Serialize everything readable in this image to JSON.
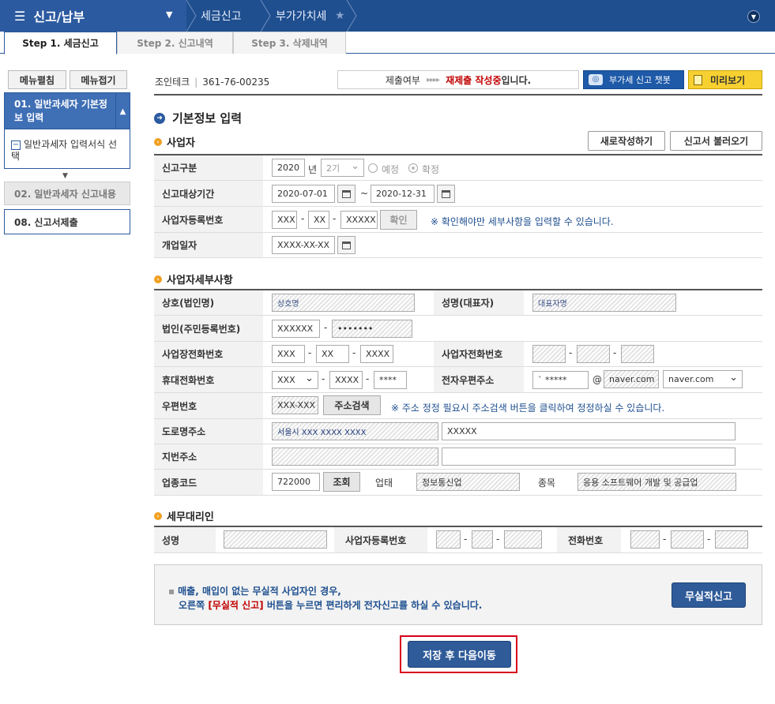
{
  "header": {
    "menu_icon": "☰",
    "menu_title": "신고/납부",
    "breadcrumb": [
      "세금신고",
      "부가가치세"
    ],
    "star_icon": "★",
    "collapse_icon": "chevron-down-icon"
  },
  "tabs": [
    {
      "label": "Step 1. 세금신고",
      "active": true
    },
    {
      "label": "Step 2. 신고내역",
      "active": false
    },
    {
      "label": "Step 3. 삭제내역",
      "active": false
    }
  ],
  "sidebar": {
    "expand_all": "메뉴펼침",
    "collapse_all": "메뉴접기",
    "items": [
      {
        "label": "01. 일반과세자 기본정보 입력",
        "active": true
      },
      {
        "label": "일반과세자 입력서식 선택"
      },
      {
        "label": "02. 일반과세자 신고내용"
      },
      {
        "label": "08. 신고서제출"
      }
    ]
  },
  "toolbar": {
    "company": "조인테크",
    "biz_no": "361-76-00235",
    "status_label": "제출여부",
    "status_arrows": "▸▸▸▸",
    "status_value": "재제출 작성중",
    "status_suffix": "입니다.",
    "chatbot": "부가세 신고 챗봇",
    "preview": "미리보기"
  },
  "main": {
    "title": "기본정보 입력",
    "business": {
      "heading": "사업자",
      "new_button": "새로작성하기",
      "load_button": "신고서 불러오기",
      "labels": [
        "신고구분",
        "신고대상기간",
        "사업자등록번호",
        "개업일자"
      ],
      "year": "2020",
      "year_unit": "년",
      "period": "2기",
      "radio_scheduled": "예정",
      "radio_confirmed": "확정",
      "date_from": "2020-07-01",
      "tilde": "~",
      "date_to": "2020-12-31",
      "biz_no_1": "XXX",
      "biz_no_2": "XX",
      "biz_no_3": "XXXXX",
      "confirm": "확인",
      "confirm_note": "※ 확인해야만 세부사항을 입력할 수 있습니다.",
      "open_date": "XXXX-XX-XX"
    },
    "details": {
      "heading": "사업자세부사항",
      "labels": {
        "trade_name": "상호(법인명)",
        "rep_name": "성명(대표자)",
        "corp_id": "법인(주민등록번호)",
        "biz_phone": "사업장전화번호",
        "owner_phone": "사업자전화번호",
        "mobile": "휴대전화번호",
        "email": "전자우편주소",
        "zip": "우편번호",
        "road_addr": "도로명주소",
        "lot_addr": "지번주소",
        "industry_code": "업종코드",
        "biz_type": "업태",
        "biz_item": "종목"
      },
      "trade_name": "상호명",
      "rep_name": "대표자명",
      "corp_id_1": "XXXXXX",
      "corp_id_2": "•••••••",
      "biz_phone_1": "XXX",
      "biz_phone_2": "XX",
      "biz_phone_3": "XXXX",
      "mobile_1": "XXX",
      "mobile_2": "XXXX",
      "mobile_3": "****",
      "email_id": "` *****",
      "at": "@",
      "email_domain": "naver.com",
      "email_select": "naver.com",
      "zip": "XXX-XXX",
      "zip_search": "주소검색",
      "zip_note": "※ 주소 정정 필요시 주소검색 버튼을 클릭하여 정정하실 수 있습니다.",
      "road_addr_1": "서울시 XXX XXXX XXXX",
      "road_addr_2": "XXXXX",
      "industry_code": "722000",
      "industry_lookup": "조회",
      "biz_type": "정보통신업",
      "biz_item": "응용 소프트웨어 개발 및 공급업"
    },
    "agent": {
      "heading": "세무대리인",
      "labels": [
        "성명",
        "사업자등록번호",
        "전화번호"
      ]
    },
    "dash": "-",
    "info": {
      "bullet": "▪",
      "line1": "매출, 매입이 없는 무실적 사업자인 경우,",
      "line2_pre": "오른쪽 ",
      "line2_red": "[무실적 신고]",
      "line2_post": " 버튼을 누르면 편리하게 전자신고를 하실 수 있습니다.",
      "null_report": "무실적신고"
    },
    "save_next": "저장 후 다음이동"
  },
  "colors": {
    "primary": "#2c5aa0",
    "topbar": "#1f4f8f",
    "accent_red": "#c00000",
    "preview_yellow": "#f7d131"
  }
}
